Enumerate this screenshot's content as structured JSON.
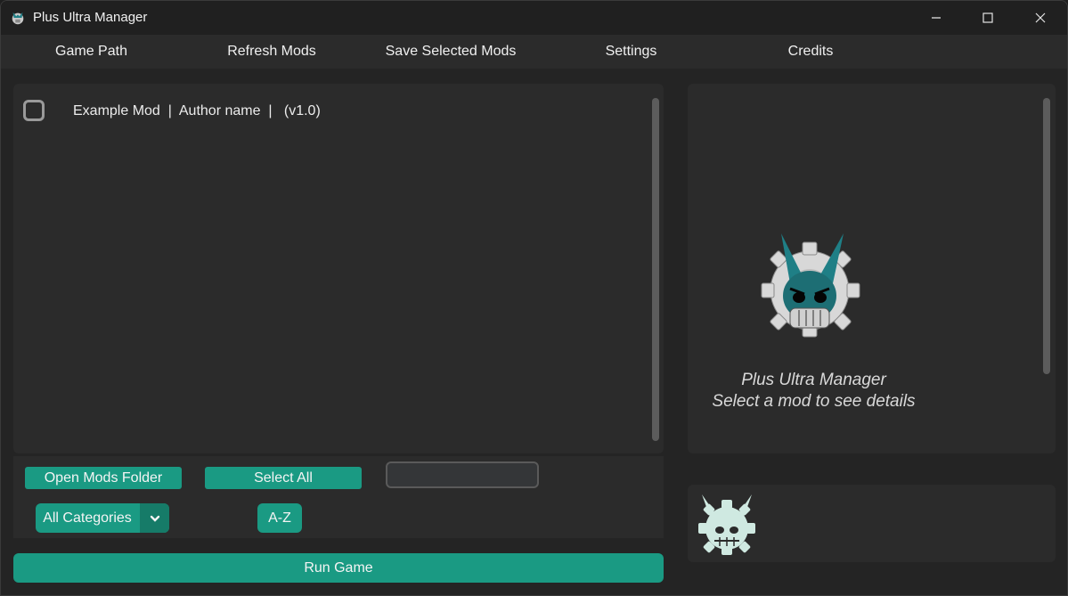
{
  "window": {
    "title": "Plus Ultra Manager"
  },
  "icons": {
    "app": "app-logo-icon",
    "minimize": "minimize-icon",
    "maximize": "maximize-icon",
    "close": "close-icon",
    "dropdown": "chevron-down-icon"
  },
  "menu": {
    "items": [
      {
        "label": "Game Path"
      },
      {
        "label": "Refresh Mods"
      },
      {
        "label": "Save Selected Mods"
      },
      {
        "label": "Settings"
      },
      {
        "label": "Credits"
      }
    ]
  },
  "mods": {
    "list": [
      {
        "label": "Example Mod  |  Author name  |   (v1.0)",
        "checked": false
      }
    ]
  },
  "controls": {
    "open_folder_label": "Open Mods Folder",
    "select_all_label": "Select All",
    "search_value": "",
    "category_selected": "All Categories",
    "sort_label": "A-Z"
  },
  "run_label": "Run Game",
  "details": {
    "title": "Plus Ultra Manager",
    "subtitle": "Select a mod to see details"
  },
  "colors": {
    "accent": "#1a9a83",
    "accent_dark": "#167b68",
    "panel": "#2b2b2b",
    "background": "#242424",
    "logo_teal": "#1f7f86",
    "footer_logo": "#cfe9e1"
  }
}
